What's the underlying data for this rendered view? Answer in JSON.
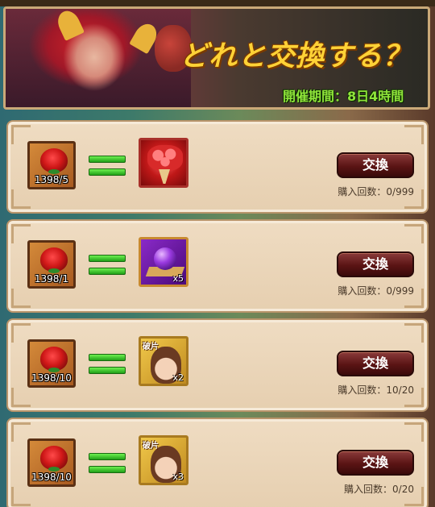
{
  "banner": {
    "title": "どれと交換する？",
    "period": "開催期間：8日4時間"
  },
  "items": [
    {
      "cost": "1398/5",
      "reward_icon": "rose-bouquet-icon",
      "reward_qty": "",
      "reward_tag": "",
      "button": "交換",
      "count": "購入回数：0/999"
    },
    {
      "cost": "1398/1",
      "reward_icon": "purple-orb-icon",
      "reward_qty": "x5",
      "reward_tag": "",
      "button": "交換",
      "count": "購入回数：0/999"
    },
    {
      "cost": "1398/10",
      "reward_icon": "character-shard-icon",
      "reward_qty": "x2",
      "reward_tag": "破片",
      "button": "交換",
      "count": "購入回数：10/20"
    },
    {
      "cost": "1398/10",
      "reward_icon": "character-shard-icon",
      "reward_qty": "x3",
      "reward_tag": "破片",
      "button": "交換",
      "count": "購入回数：0/20"
    }
  ],
  "colors": {
    "button": "#5a1414",
    "equals": "#3ec82e",
    "period": "#8fe43a",
    "title": "#ffd236"
  }
}
